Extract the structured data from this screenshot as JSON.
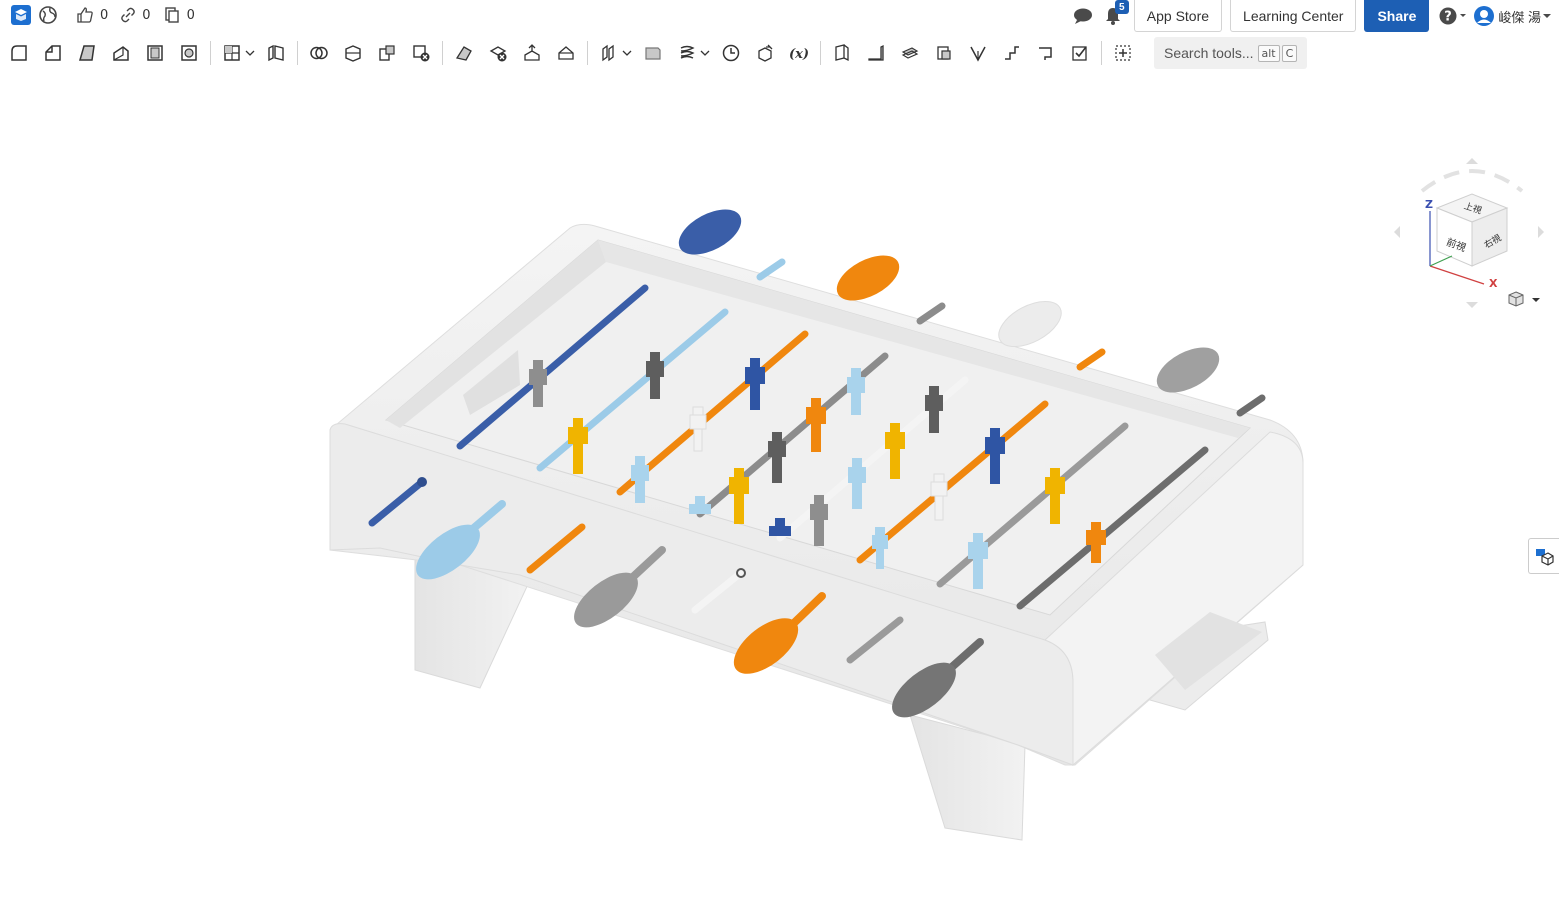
{
  "topbar": {
    "app_logo": "onshape-logo-icon",
    "globe_icon": "globe-icon",
    "likes": "0",
    "links": "0",
    "copies": "0",
    "notifications_count": "5",
    "app_store_label": "App Store",
    "learning_center_label": "Learning Center",
    "share_label": "Share",
    "user_name": "峻傑 湯"
  },
  "toolbar": {
    "tools": [
      "sketch",
      "extrude",
      "revolve",
      "sweep",
      "loft",
      "thicken",
      "fillet",
      "chamfer",
      "draft",
      "rib",
      "shell",
      "hole",
      "boolean",
      "split",
      "transform",
      "pattern",
      "mirror",
      "mate-connector",
      "helix",
      "plane",
      "offset-surface",
      "variable",
      "fit-spline",
      "sheet-metal",
      "flange",
      "hem",
      "tab",
      "bend",
      "form",
      "corner",
      "bend-relief",
      "finish",
      "insert"
    ],
    "search_label": "Search tools...",
    "shortcut_key1": "alt",
    "shortcut_key2": "C"
  },
  "view_cube": {
    "top_label": "上視",
    "front_label": "前視",
    "right_label": "右視",
    "axis_z": "Z",
    "axis_x": "X"
  },
  "colors": {
    "accent": "#1d5fb4",
    "rod_darkblue": "#3a5ea8",
    "rod_lightblue": "#9ccbe8",
    "rod_orange": "#f0870e",
    "rod_gray": "#8c8c8c",
    "rod_darkgray": "#6d6d6d",
    "player_yellow": "#f0b400"
  }
}
